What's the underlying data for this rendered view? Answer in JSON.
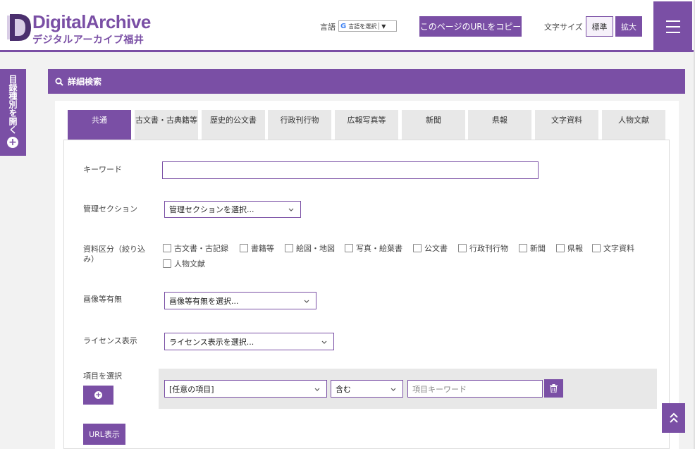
{
  "header": {
    "logo_main": "DigitalArchive",
    "logo_sub": "デジタルアーカイブ福井",
    "lang_label": "言語",
    "lang_select": "言語を選択",
    "lang_arrow": "▼",
    "copy_url_label": "このページのURLをコピー",
    "font_size_label": "文字サイズ",
    "font_std_label": "標準",
    "font_big_label": "拡大"
  },
  "side_tab": {
    "label": "目録種別を開く"
  },
  "panel": {
    "title": "詳細検索"
  },
  "tabs": [
    {
      "label": "共通",
      "active": true
    },
    {
      "label": "古文書・古典籍等",
      "active": false
    },
    {
      "label": "歴史的公文書",
      "active": false
    },
    {
      "label": "行政刊行物",
      "active": false
    },
    {
      "label": "広報写真等",
      "active": false
    },
    {
      "label": "新聞",
      "active": false
    },
    {
      "label": "県報",
      "active": false
    },
    {
      "label": "文字資料",
      "active": false
    },
    {
      "label": "人物文献",
      "active": false
    }
  ],
  "form": {
    "keyword_label": "キーワード",
    "keyword_value": "",
    "section_label": "管理セクション",
    "section_value": "管理セクションを選択...",
    "category_label": "資料区分（絞り込み）",
    "categories": [
      "古文書・古記録",
      "書籍等",
      "絵図・地図",
      "写真・絵葉書",
      "公文書",
      "行政刊行物",
      "新聞",
      "県報",
      "文字資料",
      "人物文献"
    ],
    "image_label": "画像等有無",
    "image_value": "画像等有無を選択...",
    "license_label": "ライセンス表示",
    "license_value": "ライセンス表示を選択...",
    "item_label": "項目を選択",
    "item_field_value": "[任意の項目]",
    "item_op_value": "含む",
    "item_keyword_placeholder": "項目キーワード",
    "url_button_label": "URL表示"
  },
  "colors": {
    "accent": "#7a4fa5"
  }
}
